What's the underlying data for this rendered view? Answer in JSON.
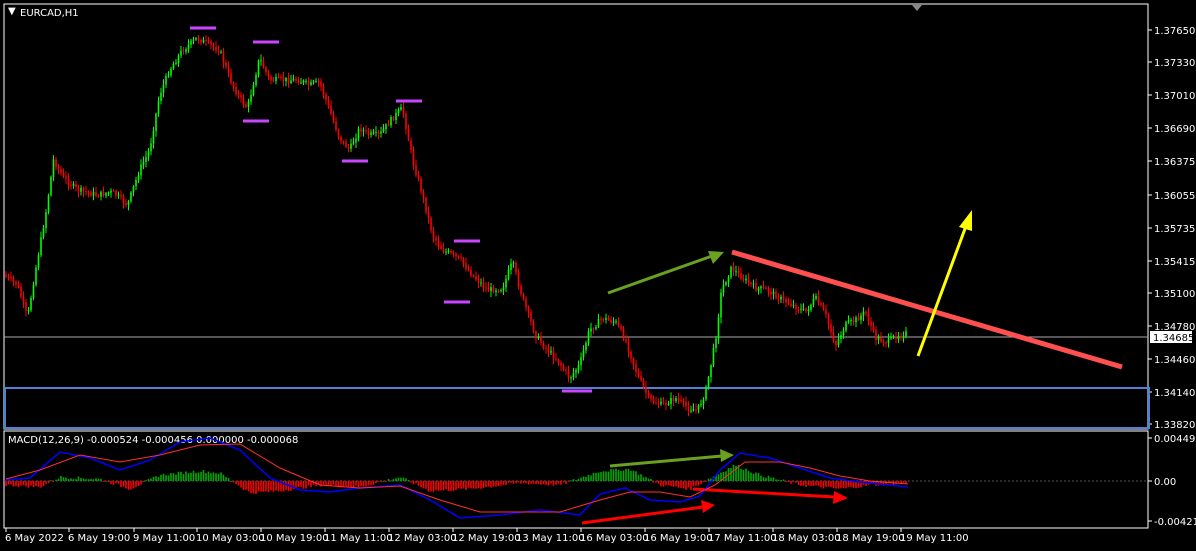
{
  "header": {
    "symbol_label": "EURCAD,H1",
    "dropdown_glyph": "▼"
  },
  "price_axis": {
    "ticks": [
      "1.37650",
      "1.37330",
      "1.37010",
      "1.36690",
      "1.36375",
      "1.36055",
      "1.35735",
      "1.35415",
      "1.35100",
      "1.34780",
      "1.34460",
      "1.34140",
      "1.33820"
    ],
    "current_price": "1.34685"
  },
  "macd": {
    "label": "MACD(12,26,9) -0.000524 -0.000456 0.000000 -0.000068",
    "ticks": [
      "0.004493",
      "0.00",
      "-0.004219"
    ]
  },
  "time_axis": {
    "ticks": [
      "6 May 2022",
      "6 May 19:00",
      "9 May 11:00",
      "10 May 03:00",
      "10 May 19:00",
      "11 May 11:00",
      "12 May 03:00",
      "12 May 19:00",
      "13 May 11:00",
      "16 May 03:00",
      "16 May 19:00",
      "17 May 11:00",
      "18 May 03:00",
      "18 May 19:00",
      "19 May 11:00"
    ]
  },
  "colors": {
    "background": "#000000",
    "bull_candle": "#00ff00",
    "bear_candle": "#ff0000",
    "grid_axis": "#ffffff",
    "macd_hist_pos": "#00aa00",
    "macd_hist_neg": "#ff0000",
    "macd_line": "#0000ff",
    "signal_line": "#ff0000",
    "trendline": "#ff5050",
    "zone_box": "#4f81d8",
    "level_marks": "#cc44ff",
    "arrow_up": "#ffff00",
    "arrow_green": "#6aa121",
    "arrow_red": "#ff0000"
  },
  "chart_data": {
    "type": "candlestick",
    "title": "EURCAD,H1",
    "ylim": [
      1.337,
      1.378
    ],
    "current_price": 1.34685,
    "trendline": {
      "from": {
        "time": "17 May 07:00",
        "price": 1.3549
      },
      "to": {
        "time": "19 May 23:00",
        "price": 1.3443
      }
    },
    "support_zone": [
      1.3375,
      1.3415
    ],
    "indicator": {
      "name": "MACD",
      "params": [
        12,
        26,
        9
      ],
      "values": [
        -0.000524,
        -0.000456,
        0.0,
        -6.8e-05
      ],
      "ylim": [
        -0.004219,
        0.004493
      ]
    }
  }
}
